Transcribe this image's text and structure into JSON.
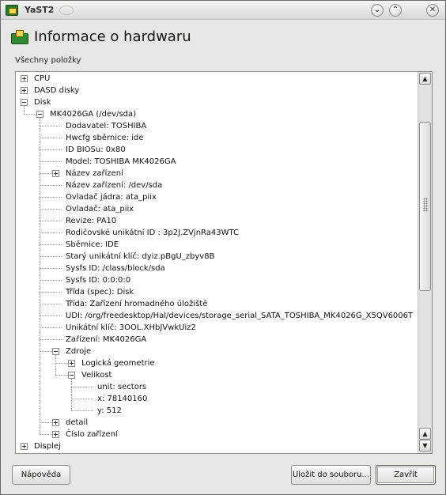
{
  "window": {
    "title": "YaST2",
    "buttons": {
      "minimize": "⌄",
      "maximize": "⌃",
      "close": "✕"
    }
  },
  "header": {
    "title": "Informace o hardwaru",
    "icon": "hardware-board-icon"
  },
  "list_label": "Všechny položky",
  "tree": {
    "rows": [
      {
        "text": "CPU",
        "level": 0,
        "expander": "plus"
      },
      {
        "text": "DASD disky",
        "level": 0,
        "expander": "plus"
      },
      {
        "text": "Disk",
        "level": 0,
        "expander": "minus"
      },
      {
        "text": "MK4026GA (/dev/sda)",
        "level": 1,
        "expander": "minus"
      },
      {
        "text": "Dodavatel: TOSHIBA",
        "level": 2,
        "expander": ""
      },
      {
        "text": "Hwcfg sběrnice: ide",
        "level": 2,
        "expander": ""
      },
      {
        "text": "ID BIOSu: 0x80",
        "level": 2,
        "expander": ""
      },
      {
        "text": "Model: TOSHIBA MK4026GA",
        "level": 2,
        "expander": ""
      },
      {
        "text": "Název zařízení",
        "level": 2,
        "expander": "plus"
      },
      {
        "text": "Název zařízení: /dev/sda",
        "level": 2,
        "expander": ""
      },
      {
        "text": "Ovladač jádra: ata_piix",
        "level": 2,
        "expander": ""
      },
      {
        "text": "Ovladač: ata_piix",
        "level": 2,
        "expander": ""
      },
      {
        "text": "Revize: PA10",
        "level": 2,
        "expander": ""
      },
      {
        "text": "Rodičovské unikátní ID : 3p2J.ZVjnRa43WTC",
        "level": 2,
        "expander": ""
      },
      {
        "text": "Sběrnice: IDE",
        "level": 2,
        "expander": ""
      },
      {
        "text": "Starý unikátní klíč: dyiz.pBgU_zbyv8B",
        "level": 2,
        "expander": ""
      },
      {
        "text": "Sysfs ID: /class/block/sda",
        "level": 2,
        "expander": ""
      },
      {
        "text": "Sysfs ID: 0:0:0:0",
        "level": 2,
        "expander": ""
      },
      {
        "text": "Třída (spec): Disk",
        "level": 2,
        "expander": ""
      },
      {
        "text": "Třída: Zařízení hromadného úložiště",
        "level": 2,
        "expander": ""
      },
      {
        "text": "UDI: /org/freedesktop/Hal/devices/storage_serial_SATA_TOSHIBA_MK4026G_X5QV6006T",
        "level": 2,
        "expander": ""
      },
      {
        "text": "Unikátní klíč: 3OOL.XHbJVwkUiz2",
        "level": 2,
        "expander": ""
      },
      {
        "text": "Zařízení: MK4026GA",
        "level": 2,
        "expander": ""
      },
      {
        "text": "Zdroje",
        "level": 2,
        "expander": "minus"
      },
      {
        "text": "Logická geometrie",
        "level": 3,
        "expander": "plus"
      },
      {
        "text": "Velikost",
        "level": 3,
        "expander": "minus"
      },
      {
        "text": "unit: sectors",
        "level": 4,
        "expander": ""
      },
      {
        "text": "x: 78140160",
        "level": 4,
        "expander": ""
      },
      {
        "text": "y: 512",
        "level": 4,
        "expander": ""
      },
      {
        "text": "detail",
        "level": 2,
        "expander": "plus"
      },
      {
        "text": "Číslo zařízení",
        "level": 2,
        "expander": "plus"
      },
      {
        "text": "Displej",
        "level": 0,
        "expander": "plus"
      }
    ]
  },
  "scrollbar": {
    "up": "▲",
    "down": "▼"
  },
  "buttons": {
    "help": "Nápověda",
    "save": "Uložit do souboru...",
    "close": "Zavřít"
  }
}
